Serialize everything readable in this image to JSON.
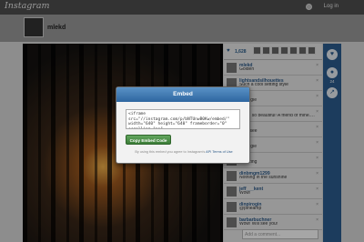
{
  "topbar": {
    "logo": "Instagram",
    "login": "Log in"
  },
  "profile": {
    "username": "mlekd"
  },
  "stats": {
    "likes": "1,628"
  },
  "comments": [
    {
      "user": "mlekd",
      "text": "Golden"
    },
    {
      "user": "lightsandsilhouettes",
      "text": "Such a cool setting style"
    },
    {
      "user": "___",
      "text": "@reggie"
    },
    {
      "user": "___",
      "text": "Wow! so beautiful! A friend of mine... It's gorgeous this week! I want..."
    },
    {
      "user": "___",
      "text": "@jessee"
    },
    {
      "user": "___",
      "text": "@reggie"
    },
    {
      "user": "___",
      "text": "Amazing"
    },
    {
      "user": "dinbmgm1299",
      "text": "Nothing in the sunshine"
    },
    {
      "user": "jeff___kent",
      "text": "Wow!"
    },
    {
      "user": "dinpirogin",
      "text": "@pineamp"
    },
    {
      "user": "barbarbuchner",
      "text": "Wow! Will see you!"
    }
  ],
  "add_comment_placeholder": "Add a comment...",
  "rail": {
    "like_count": "",
    "comment_count": "24"
  },
  "modal": {
    "title": "Embed",
    "code": "<iframe src=\"//instagram.com/p/bNTUnwB0Kw/embed/\" width=\"640\" height=\"640\" frameborder=\"0\" scrolling=\"no\" ...",
    "copy_label": "Copy Embed Code",
    "terms_prefix": "By using this embed you agree to Instagram's",
    "terms_link": "API Terms of Use"
  }
}
